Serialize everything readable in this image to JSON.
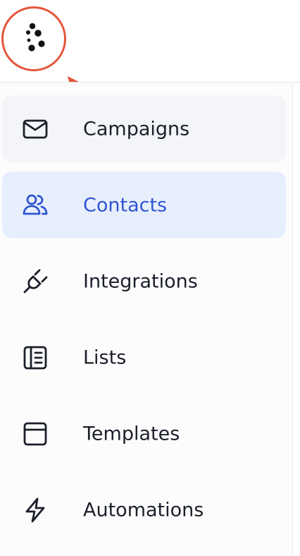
{
  "logo": {
    "icon": "dots-logo-icon",
    "color": "#111111"
  },
  "annotation": {
    "color": "#e4553a"
  },
  "sidebar": {
    "active_color": "#2f55d4",
    "items": [
      {
        "label": "Campaigns",
        "icon": "mail-icon",
        "state": "hover"
      },
      {
        "label": "Contacts",
        "icon": "users-icon",
        "state": "active"
      },
      {
        "label": "Integrations",
        "icon": "plug-icon",
        "state": "default"
      },
      {
        "label": "Lists",
        "icon": "list-book-icon",
        "state": "default"
      },
      {
        "label": "Templates",
        "icon": "template-icon",
        "state": "default"
      },
      {
        "label": "Automations",
        "icon": "lightning-icon",
        "state": "default"
      }
    ]
  }
}
